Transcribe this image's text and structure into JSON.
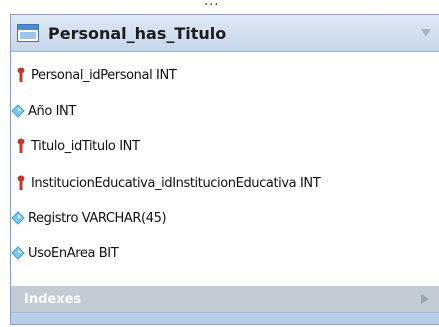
{
  "overflow_indicator": "...",
  "table": {
    "name": "Personal_has_Titulo",
    "columns": [
      {
        "text": "Personal_idPersonal INT",
        "icon": "key-icon"
      },
      {
        "text": "Año INT",
        "icon": "diamond-icon"
      },
      {
        "text": "Titulo_idTitulo INT",
        "icon": "key-icon"
      },
      {
        "text": "InstitucionEducativa_idInstitucionEducativa INT",
        "icon": "key-icon"
      },
      {
        "text": "Registro VARCHAR(45)",
        "icon": "diamond-icon"
      },
      {
        "text": "UsoEnArea BIT",
        "icon": "diamond-icon"
      }
    ],
    "indexes_label": "Indexes"
  },
  "colors": {
    "key": "#c0392b",
    "diamond": "#7ec8e3",
    "header_bg": "#d3e0f0",
    "indexes_bg": "#c3cbd4",
    "footer_bg": "#b9cde6"
  }
}
